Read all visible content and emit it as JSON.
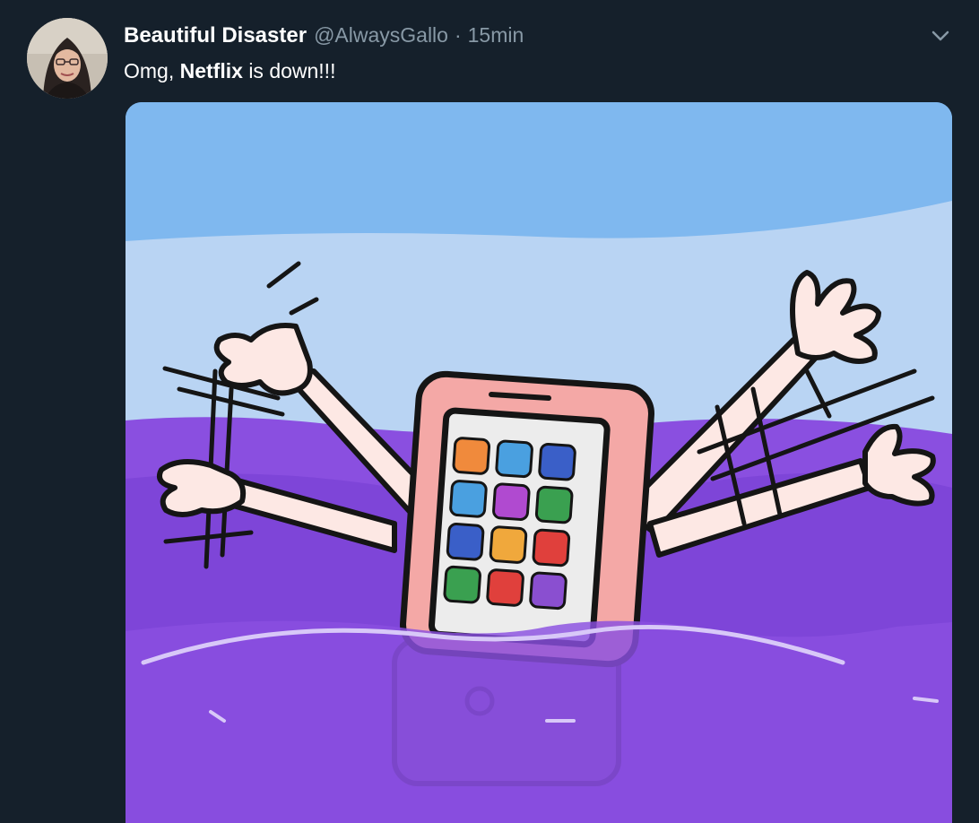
{
  "tweet": {
    "display_name": "Beautiful Disaster",
    "handle": "@AlwaysGallo",
    "separator": "·",
    "time": "15min",
    "text_before": "Omg,",
    "text_bold": "Netflix",
    "text_after": "is down!!!"
  },
  "icons": {
    "more": "chevron-down-icon",
    "avatar": "user-photo"
  },
  "colors": {
    "background": "#15202b",
    "name": "#ffffff",
    "meta": "#8899a6",
    "sky": "#7fb8ef",
    "water": "#8a4fe0",
    "phone": "#f2a6a4"
  }
}
